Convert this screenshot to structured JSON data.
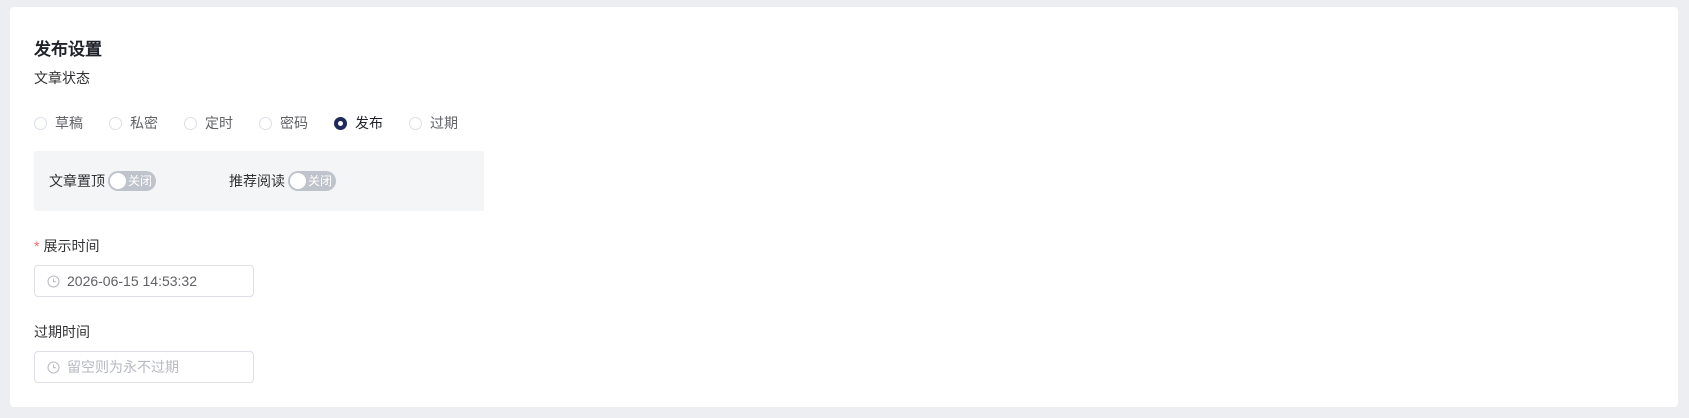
{
  "publish_settings": {
    "title": "发布设置",
    "status": {
      "label": "文章状态",
      "options": [
        {
          "label": "草稿",
          "checked": false
        },
        {
          "label": "私密",
          "checked": false
        },
        {
          "label": "定时",
          "checked": false
        },
        {
          "label": "密码",
          "checked": false
        },
        {
          "label": "发布",
          "checked": true
        },
        {
          "label": "过期",
          "checked": false
        }
      ]
    },
    "toggles": {
      "pin_top": {
        "label": "文章置顶",
        "state_text": "关闭",
        "on": false
      },
      "recommend": {
        "label": "推荐阅读",
        "state_text": "关闭",
        "on": false
      }
    },
    "display_time": {
      "required_mark": "*",
      "label": "展示时间",
      "value": "2026-06-15 14:53:32",
      "placeholder": ""
    },
    "expire_time": {
      "label": "过期时间",
      "value": "",
      "placeholder": "留空则为永不过期"
    }
  },
  "colors": {
    "page_background": "#eceef2",
    "card_background": "#ffffff",
    "accent": "#1e2a5a",
    "required": "#f56c6c",
    "switch_off": "#bfc3cb",
    "panel_background": "#f4f5f7"
  },
  "icons": {
    "date_input_prefix": "clock-icon"
  }
}
